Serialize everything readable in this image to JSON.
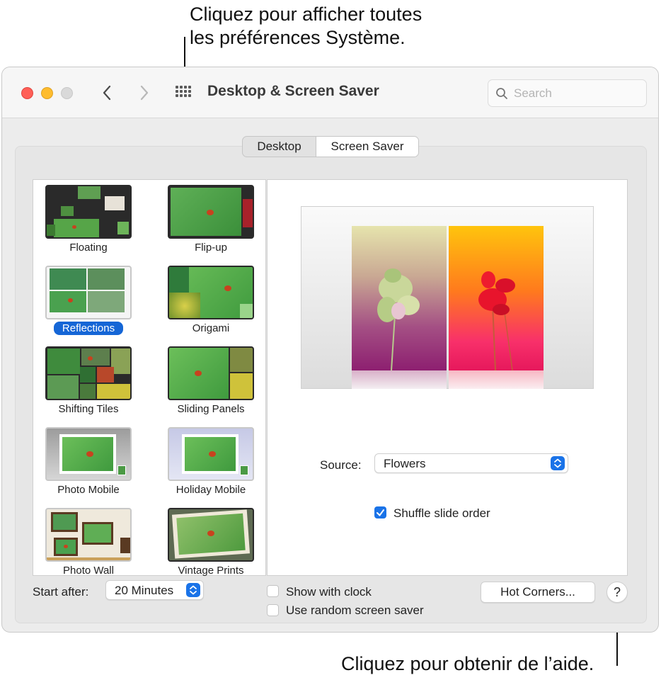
{
  "callouts": {
    "top_line1": "Cliquez pour afficher toutes",
    "top_line2": "les préférences Système.",
    "bottom": "Cliquez pour obtenir de l’aide."
  },
  "window": {
    "title": "Desktop & Screen Saver",
    "search_placeholder": "Search"
  },
  "tabs": [
    "Desktop",
    "Screen Saver"
  ],
  "selected_tab": "Screen Saver",
  "savers": [
    {
      "label": "Floating",
      "icon": "floating-thumbnail"
    },
    {
      "label": "Flip-up",
      "icon": "flip-up-thumbnail"
    },
    {
      "label": "Reflections",
      "icon": "reflections-thumbnail",
      "selected": true
    },
    {
      "label": "Origami",
      "icon": "origami-thumbnail"
    },
    {
      "label": "Shifting Tiles",
      "icon": "shifting-tiles-thumbnail"
    },
    {
      "label": "Sliding Panels",
      "icon": "sliding-panels-thumbnail"
    },
    {
      "label": "Photo Mobile",
      "icon": "photo-mobile-thumbnail"
    },
    {
      "label": "Holiday Mobile",
      "icon": "holiday-mobile-thumbnail"
    },
    {
      "label": "Photo Wall",
      "icon": "photo-wall-thumbnail"
    },
    {
      "label": "Vintage Prints",
      "icon": "vintage-prints-thumbnail"
    }
  ],
  "options": {
    "source_label": "Source:",
    "source_value": "Flowers",
    "shuffle_label": "Shuffle slide order",
    "shuffle_checked": true
  },
  "footer": {
    "start_after_label": "Start after:",
    "start_after_value": "20 Minutes",
    "show_clock_label": "Show with clock",
    "show_clock_checked": false,
    "random_label": "Use random screen saver",
    "random_checked": false,
    "hot_corners_label": "Hot Corners...",
    "help_label": "?"
  },
  "colors": {
    "accent": "#1a73e8",
    "selection": "#1566d6",
    "close": "#ff5f57",
    "minimize": "#febc2e"
  }
}
